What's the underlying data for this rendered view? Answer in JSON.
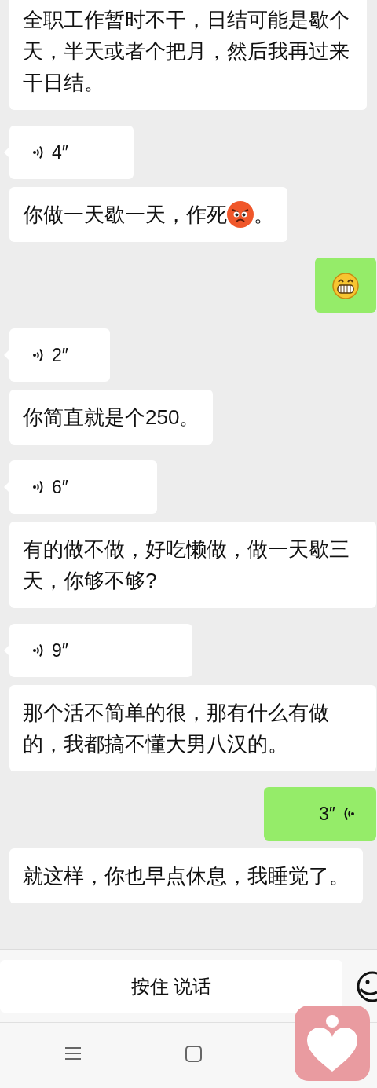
{
  "messages": [
    {
      "kind": "text",
      "outgoing": false,
      "cut_top": true,
      "text": "全职工作暂时不干，日结可能是歇个天，半天或者个把月，然后我再过来干日结。"
    },
    {
      "kind": "voice",
      "outgoing": false,
      "duration": "4″"
    },
    {
      "kind": "text",
      "outgoing": false,
      "cut_top": false,
      "text": "你做一天歇一天，作死",
      "emoji": {
        "kind": "angry"
      },
      "text_after": "。"
    },
    {
      "kind": "emoji",
      "outgoing": true,
      "emoji": {
        "kind": "grin"
      }
    },
    {
      "kind": "voice",
      "outgoing": false,
      "duration": "2″"
    },
    {
      "kind": "text",
      "outgoing": false,
      "cut_top": false,
      "text": "你简直就是个250。"
    },
    {
      "kind": "voice",
      "outgoing": false,
      "duration": "6″"
    },
    {
      "kind": "text",
      "outgoing": false,
      "cut_top": false,
      "text": "有的做不做，好吃懒做，做一天歇三天，你够不够?"
    },
    {
      "kind": "voice",
      "outgoing": false,
      "duration": "9″"
    },
    {
      "kind": "text",
      "outgoing": false,
      "cut_top": false,
      "text": "那个活不简单的很，那有什么有做的，我都搞不懂大男八汉的。"
    },
    {
      "kind": "voice",
      "outgoing": true,
      "duration": "3″"
    },
    {
      "kind": "text",
      "outgoing": false,
      "cut_top": false,
      "text": "就这样，你也早点休息，我睡觉了。"
    }
  ],
  "input_bar": {
    "hold_to_talk": "按住 说话"
  }
}
